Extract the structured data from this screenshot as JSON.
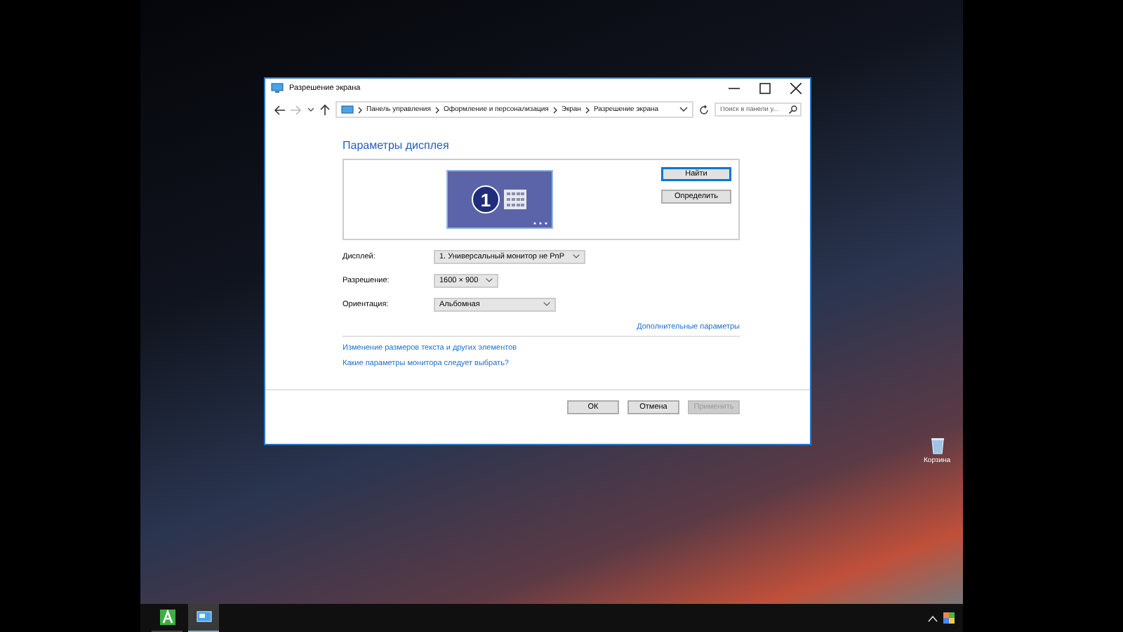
{
  "window": {
    "title": "Разрешение экрана"
  },
  "breadcrumb": [
    "Панель управления",
    "Оформление и персонализация",
    "Экран",
    "Разрешение экрана"
  ],
  "search": {
    "placeholder": "Поиск в панели у..."
  },
  "heading": "Параметры дисплея",
  "monitor": {
    "number": "1"
  },
  "preview_buttons": [
    {
      "label": "Найти",
      "focused": true
    },
    {
      "label": "Определить",
      "focused": false
    }
  ],
  "fields": [
    {
      "label": "Дисплей:",
      "value": "1. Универсальный монитор не PnP"
    },
    {
      "label": "Разрешение:",
      "value": "1600 × 900"
    },
    {
      "label": "Ориентация:",
      "value": "Альбомная"
    }
  ],
  "advanced_link": "Дополнительные параметры",
  "links": [
    "Изменение размеров текста и других элементов",
    "Какие параметры монитора следует выбрать?"
  ],
  "buttons": [
    {
      "label": "ОК",
      "disabled": false
    },
    {
      "label": "Отмена",
      "disabled": false
    },
    {
      "label": "Применить",
      "disabled": true
    }
  ],
  "desktop_icons": [
    {
      "label": "Корзина"
    }
  ],
  "taskbar": {
    "items": [
      {
        "kind": "app",
        "selected": false
      },
      {
        "kind": "control-panel",
        "selected": true
      }
    ]
  }
}
